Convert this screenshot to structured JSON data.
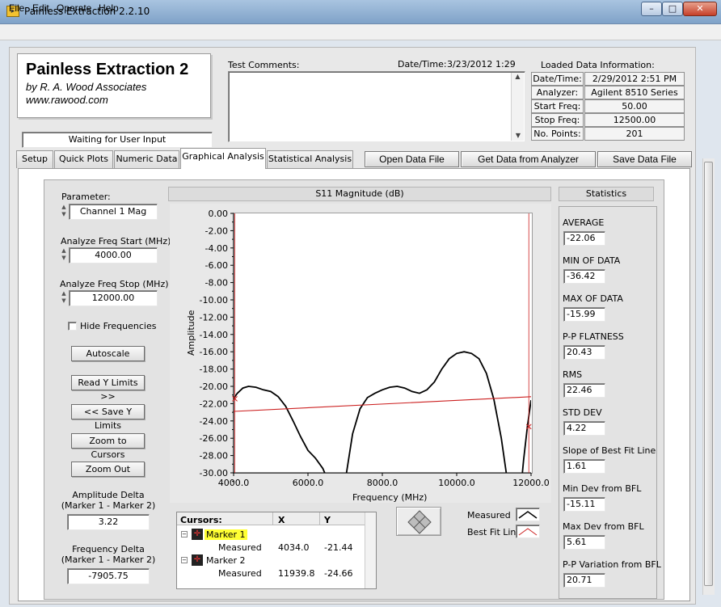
{
  "window": {
    "title": "Painless Extraction 2.2.10",
    "close": "✕",
    "min": "–",
    "max": "□"
  },
  "menu": [
    "File",
    "Edit",
    "Operate",
    "Help"
  ],
  "logo": {
    "title": "Painless Extraction 2",
    "by": "by R. A. Wood Associates",
    "url": "www.rawood.com"
  },
  "status": "Waiting for User Input",
  "comments": {
    "label": "Test Comments:",
    "value": ""
  },
  "datetime": {
    "label": "Date/Time:",
    "date": "3/23/2012",
    "time": "1:29"
  },
  "loaded": {
    "title": "Loaded Data Information:",
    "rows": [
      {
        "key": "Date/Time:",
        "value": "2/29/2012 2:51 PM"
      },
      {
        "key": "Analyzer:",
        "value": "Agilent 8510 Series"
      },
      {
        "key": "Start Freq:",
        "value": "50.00"
      },
      {
        "key": "Stop Freq:",
        "value": "12500.00"
      },
      {
        "key": "No. Points:",
        "value": "201"
      }
    ]
  },
  "tabs": [
    "Setup",
    "Quick Plots",
    "Numeric Data",
    "Graphical Analysis",
    "Statistical Analysis"
  ],
  "active_tab": "Graphical Analysis",
  "actions": {
    "open": "Open Data File",
    "get": "Get Data from Analyzer",
    "save": "Save Data File"
  },
  "controls": {
    "parameter_label": "Parameter:",
    "parameter_value": "Channel 1 Mag",
    "start_label": "Analyze Freq Start (MHz)",
    "start_value": "4000.00",
    "stop_label": "Analyze Freq Stop (MHz)",
    "stop_value": "12000.00",
    "hide_freq": "Hide Frequencies",
    "autoscale": "Autoscale",
    "read_y": "Read Y Limits >>",
    "save_y": "<< Save Y Limits",
    "zoom_cursors": "Zoom to Cursors",
    "zoom_out": "Zoom Out",
    "amp_delta_label1": "Amplitude Delta",
    "amp_delta_label2": "(Marker 1 - Marker 2)",
    "amp_delta_value": "3.22",
    "freq_delta_label1": "Frequency Delta",
    "freq_delta_label2": "(Marker 1 - Marker 2)",
    "freq_delta_value": "-7905.75"
  },
  "cursors": {
    "header": {
      "name": "Cursors:",
      "x": "X",
      "y": "Y"
    },
    "markers": [
      {
        "name": "Marker 1",
        "sub": "Measured",
        "x": "4034.0",
        "y": "-21.44"
      },
      {
        "name": "Marker 2",
        "sub": "Measured",
        "x": "11939.8",
        "y": "-24.66"
      }
    ]
  },
  "legend": {
    "measured": "Measured",
    "bfl": "Best Fit Line"
  },
  "stats": {
    "header": "Statistics",
    "items": [
      {
        "label": "AVERAGE",
        "value": "-22.06"
      },
      {
        "label": "MIN OF DATA",
        "value": "-36.42"
      },
      {
        "label": "MAX OF DATA",
        "value": "-15.99"
      },
      {
        "label": "P-P FLATNESS",
        "value": "20.43"
      },
      {
        "label": "RMS",
        "value": "22.46"
      },
      {
        "label": "STD DEV",
        "value": "4.22"
      },
      {
        "label": "Slope of Best Fit Line",
        "value": "1.61"
      },
      {
        "label": "Min Dev from BFL",
        "value": "-15.11"
      },
      {
        "label": "Max Dev from BFL",
        "value": "5.61"
      },
      {
        "label": "P-P Variation from BFL",
        "value": "20.71"
      }
    ]
  },
  "colors": {
    "measured": "#000000",
    "bfl": "#cc2020",
    "marker_highlight": "#ffff33",
    "cursor_line": "#cc2020"
  },
  "chart_data": {
    "type": "line",
    "title": "S11 Magnitude (dB)",
    "xlabel": "Frequency (MHz)",
    "ylabel": "Amplitude",
    "xlim": [
      4000,
      12000
    ],
    "ylim": [
      -30,
      0
    ],
    "xticks": [
      "4000.0",
      "6000.0",
      "8000.0",
      "10000.0",
      "12000.0"
    ],
    "yticks": [
      "0.00",
      "-2.00",
      "-4.00",
      "-6.00",
      "-8.00",
      "-10.00",
      "-12.00",
      "-14.00",
      "-16.00",
      "-18.00",
      "-20.00",
      "-22.00",
      "-24.00",
      "-26.00",
      "-28.00",
      "-30.00"
    ],
    "series": [
      {
        "name": "Measured",
        "x": [
          4000,
          4100,
          4250,
          4400,
          4600,
          4800,
          5000,
          5200,
          5400,
          5600,
          5800,
          6000,
          6200,
          6400,
          6600,
          6800,
          7000,
          7200,
          7400,
          7600,
          7800,
          8000,
          8200,
          8400,
          8600,
          8800,
          9000,
          9200,
          9400,
          9600,
          9800,
          10000,
          10200,
          10400,
          10600,
          10800,
          11000,
          11200,
          11400,
          11600,
          11700,
          11800,
          11900,
          12000
        ],
        "y": [
          -21.4,
          -20.8,
          -20.2,
          -20.0,
          -20.1,
          -20.4,
          -20.6,
          -21.2,
          -22.3,
          -24.0,
          -25.8,
          -27.4,
          -28.3,
          -29.5,
          -31.5,
          -34.0,
          -31.0,
          -25.5,
          -22.6,
          -21.3,
          -20.8,
          -20.4,
          -20.1,
          -20.0,
          -20.2,
          -20.6,
          -20.8,
          -20.4,
          -19.5,
          -18.0,
          -16.8,
          -16.2,
          -16.0,
          -16.2,
          -16.8,
          -18.5,
          -21.5,
          -26.0,
          -32.0,
          -36.4,
          -33.0,
          -28.5,
          -24.7,
          -21.6
        ]
      },
      {
        "name": "Best Fit Line",
        "x": [
          4000,
          12000
        ],
        "y": [
          -22.9,
          -21.2
        ]
      }
    ],
    "cursors": [
      {
        "name": "Marker 1",
        "x": 4034.0,
        "y": -21.44
      },
      {
        "name": "Marker 2",
        "x": 11939.8,
        "y": -24.66
      }
    ]
  }
}
